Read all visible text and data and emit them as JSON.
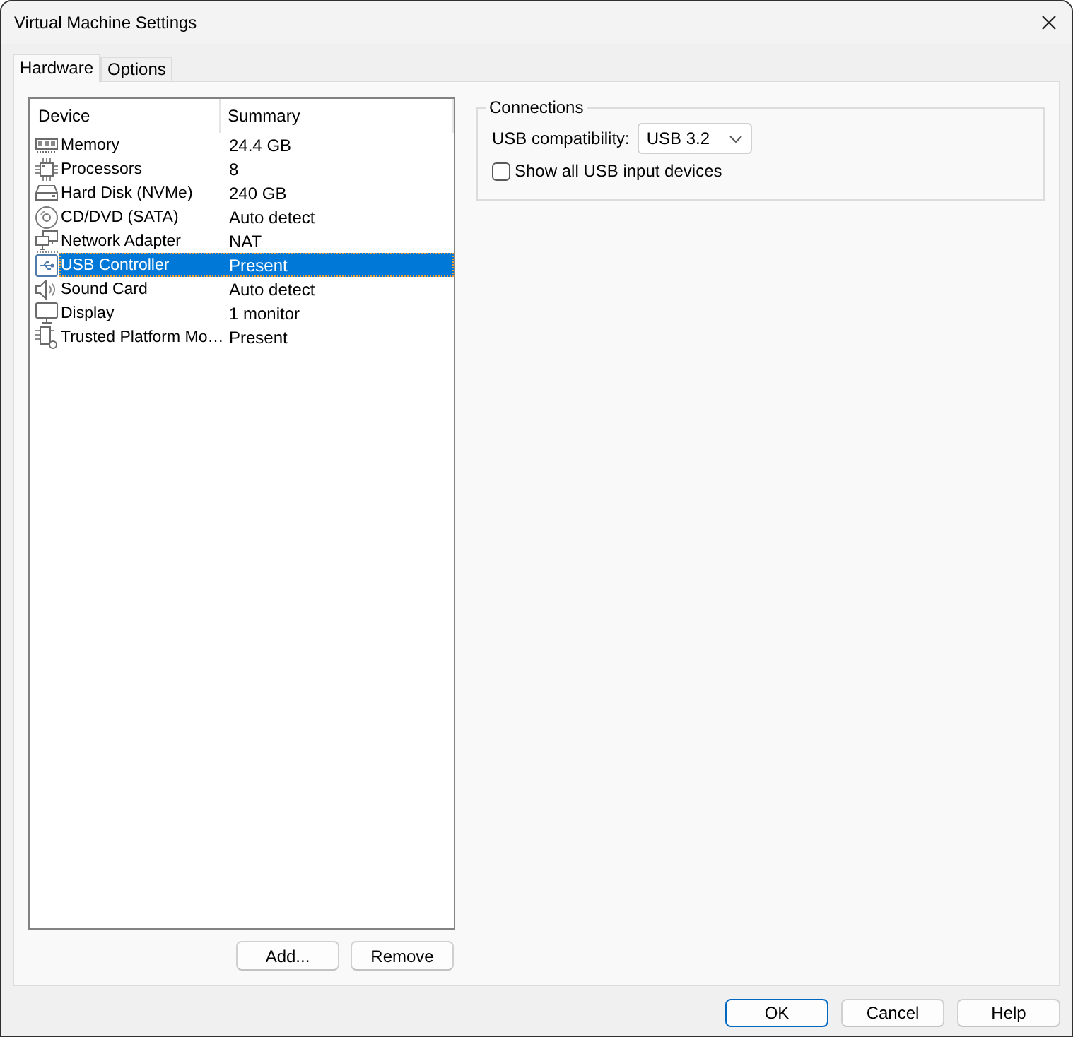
{
  "window": {
    "title": "Virtual Machine Settings"
  },
  "tabs": [
    {
      "label": "Hardware",
      "selected": true
    },
    {
      "label": "Options",
      "selected": false
    }
  ],
  "device_list": {
    "columns": [
      "Device",
      "Summary"
    ],
    "rows": [
      {
        "kind": "memory",
        "device": "Memory",
        "summary": "24.4 GB",
        "selected": false
      },
      {
        "kind": "processor",
        "device": "Processors",
        "summary": "8",
        "selected": false
      },
      {
        "kind": "disk",
        "device": "Hard Disk (NVMe)",
        "summary": "240 GB",
        "selected": false
      },
      {
        "kind": "disc",
        "device": "CD/DVD (SATA)",
        "summary": "Auto detect",
        "selected": false
      },
      {
        "kind": "network",
        "device": "Network Adapter",
        "summary": "NAT",
        "selected": false
      },
      {
        "kind": "usb",
        "device": "USB Controller",
        "summary": "Present",
        "selected": true
      },
      {
        "kind": "sound",
        "device": "Sound Card",
        "summary": "Auto detect",
        "selected": false
      },
      {
        "kind": "display",
        "device": "Display",
        "summary": "1 monitor",
        "selected": false
      },
      {
        "kind": "tpm",
        "device": "Trusted Platform Mo…",
        "summary": "Present",
        "selected": false
      }
    ]
  },
  "list_buttons": [
    "Add...",
    "Remove"
  ],
  "connections": {
    "title": "Connections",
    "usb_compatibility": {
      "label": "USB compatibility:",
      "value": "USB 3.2"
    },
    "show_all_usb_input": {
      "label": "Show all USB input devices",
      "checked": false
    }
  },
  "dialog_buttons": [
    {
      "label": "OK",
      "default": true
    },
    {
      "label": "Cancel",
      "default": false
    },
    {
      "label": "Help",
      "default": false
    }
  ]
}
